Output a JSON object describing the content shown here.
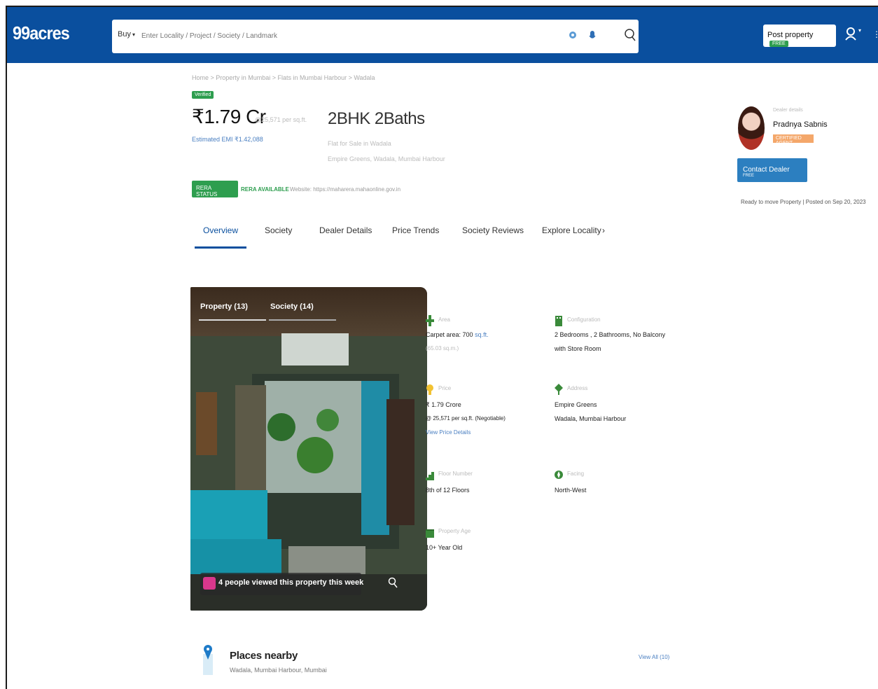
{
  "brand": {
    "logo": "99acres",
    "primary_color": "#0a4f9e",
    "accent_green": "#2e9e4f"
  },
  "search": {
    "mode": "Buy",
    "placeholder": "Enter Locality / Project / Society / Landmark",
    "icons": [
      "location-pin-icon",
      "mic-icon",
      "search-icon"
    ]
  },
  "header": {
    "post_property_label": "Post property",
    "post_property_badge": "FREE"
  },
  "property": {
    "breadcrumb": "Home > Property in Mumbai > Flats in Mumbai Harbour > Wadala",
    "verified_label": "Verified",
    "price": "₹1.79 Cr",
    "price_per_sqft": "@25,571 per sq.ft.",
    "emi": "Estimated EMI ₹1.42,088",
    "config_title": "2BHK 2Baths",
    "config_sub1": "Flat for Sale in Wadala",
    "config_sub2": "Empire Greens, Wadala, Mumbai Harbour",
    "rera_badge": "RERA STATUS",
    "rera_available": "RERA AVAILABLE",
    "rera_website": "Website: https://maharera.mahaonline.gov.in"
  },
  "tabs": [
    {
      "label": "Overview",
      "active": true
    },
    {
      "label": "Society",
      "active": false
    },
    {
      "label": "Dealer Details",
      "active": false
    },
    {
      "label": "Price Trends",
      "active": false
    },
    {
      "label": "Society Reviews",
      "active": false
    },
    {
      "label": "Explore Locality",
      "active": false
    }
  ],
  "tabs_more_glyph": "›",
  "dealer": {
    "caption": "Dealer details",
    "name": "Pradnya Sabnis",
    "badge": "CERTIFIED AGENT",
    "extra": "",
    "contact_label": "Contact Dealer",
    "contact_badge": "FREE",
    "ready_line": "Ready to move Property | Posted on Sep 20, 2023"
  },
  "gallery": {
    "tabs": [
      "Property (13)",
      "Society (14)"
    ],
    "viewed_text": "4 people viewed this property this week"
  },
  "details": {
    "area": {
      "label": "Area",
      "value": "Carpet area: 700",
      "unit": "sq.ft.",
      "sub": "(65.03 sq.m.)"
    },
    "configuration": {
      "label": "Configuration",
      "line1": "2 Bedrooms , 2 Bathrooms, No Balcony",
      "line2": "with Store Room"
    },
    "price": {
      "label": "Price",
      "line1": "₹ 1.79 Crore",
      "line2": "@ 25,571 per sq.ft. (Negotiable)",
      "link": "View Price Details"
    },
    "address": {
      "label": "Address",
      "line1": "Empire Greens",
      "line2": "Wadala, Mumbai Harbour"
    },
    "floor": {
      "label": "Floor Number",
      "value": "8th of 12 Floors"
    },
    "facing": {
      "label": "Facing",
      "value": "North-West"
    },
    "age": {
      "label": "Property Age",
      "value": "10+ Year Old"
    }
  },
  "places": {
    "title": "Places nearby",
    "sub": "Wadala, Mumbai Harbour, Mumbai",
    "view_all": "View All (10)"
  }
}
